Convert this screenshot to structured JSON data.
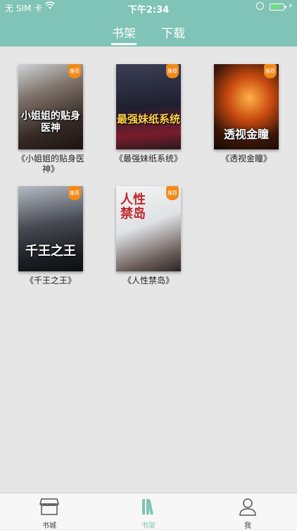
{
  "status": {
    "carrier": "无 SIM 卡",
    "time": "下午2:34"
  },
  "header": {
    "tabs": [
      {
        "label": "书架"
      },
      {
        "label": "下载"
      }
    ]
  },
  "books": [
    {
      "cover_title": "小姐姐的贴身医神",
      "badge": "推荐",
      "title": "《小姐姐的贴身医神》"
    },
    {
      "cover_title": "最强妹纸系统",
      "badge": "推荐",
      "title": "《最强妹纸系统》"
    },
    {
      "cover_title": "透视金瞳",
      "badge": "推荐",
      "title": "《透视金瞳》"
    },
    {
      "cover_title": "千王之王",
      "badge": "推荐",
      "title": "《千王之王》"
    },
    {
      "cover_title": "人性禁岛",
      "badge": "推荐",
      "title": "《人性禁岛》"
    }
  ],
  "bottom_nav": [
    {
      "label": "书城",
      "icon": "store-icon"
    },
    {
      "label": "书架",
      "icon": "bookshelf-icon",
      "active": true
    },
    {
      "label": "我",
      "icon": "user-icon"
    }
  ],
  "colors": {
    "accent": "#7fc4b6",
    "background": "#e6e6e6",
    "badge": "#f28a1a"
  }
}
